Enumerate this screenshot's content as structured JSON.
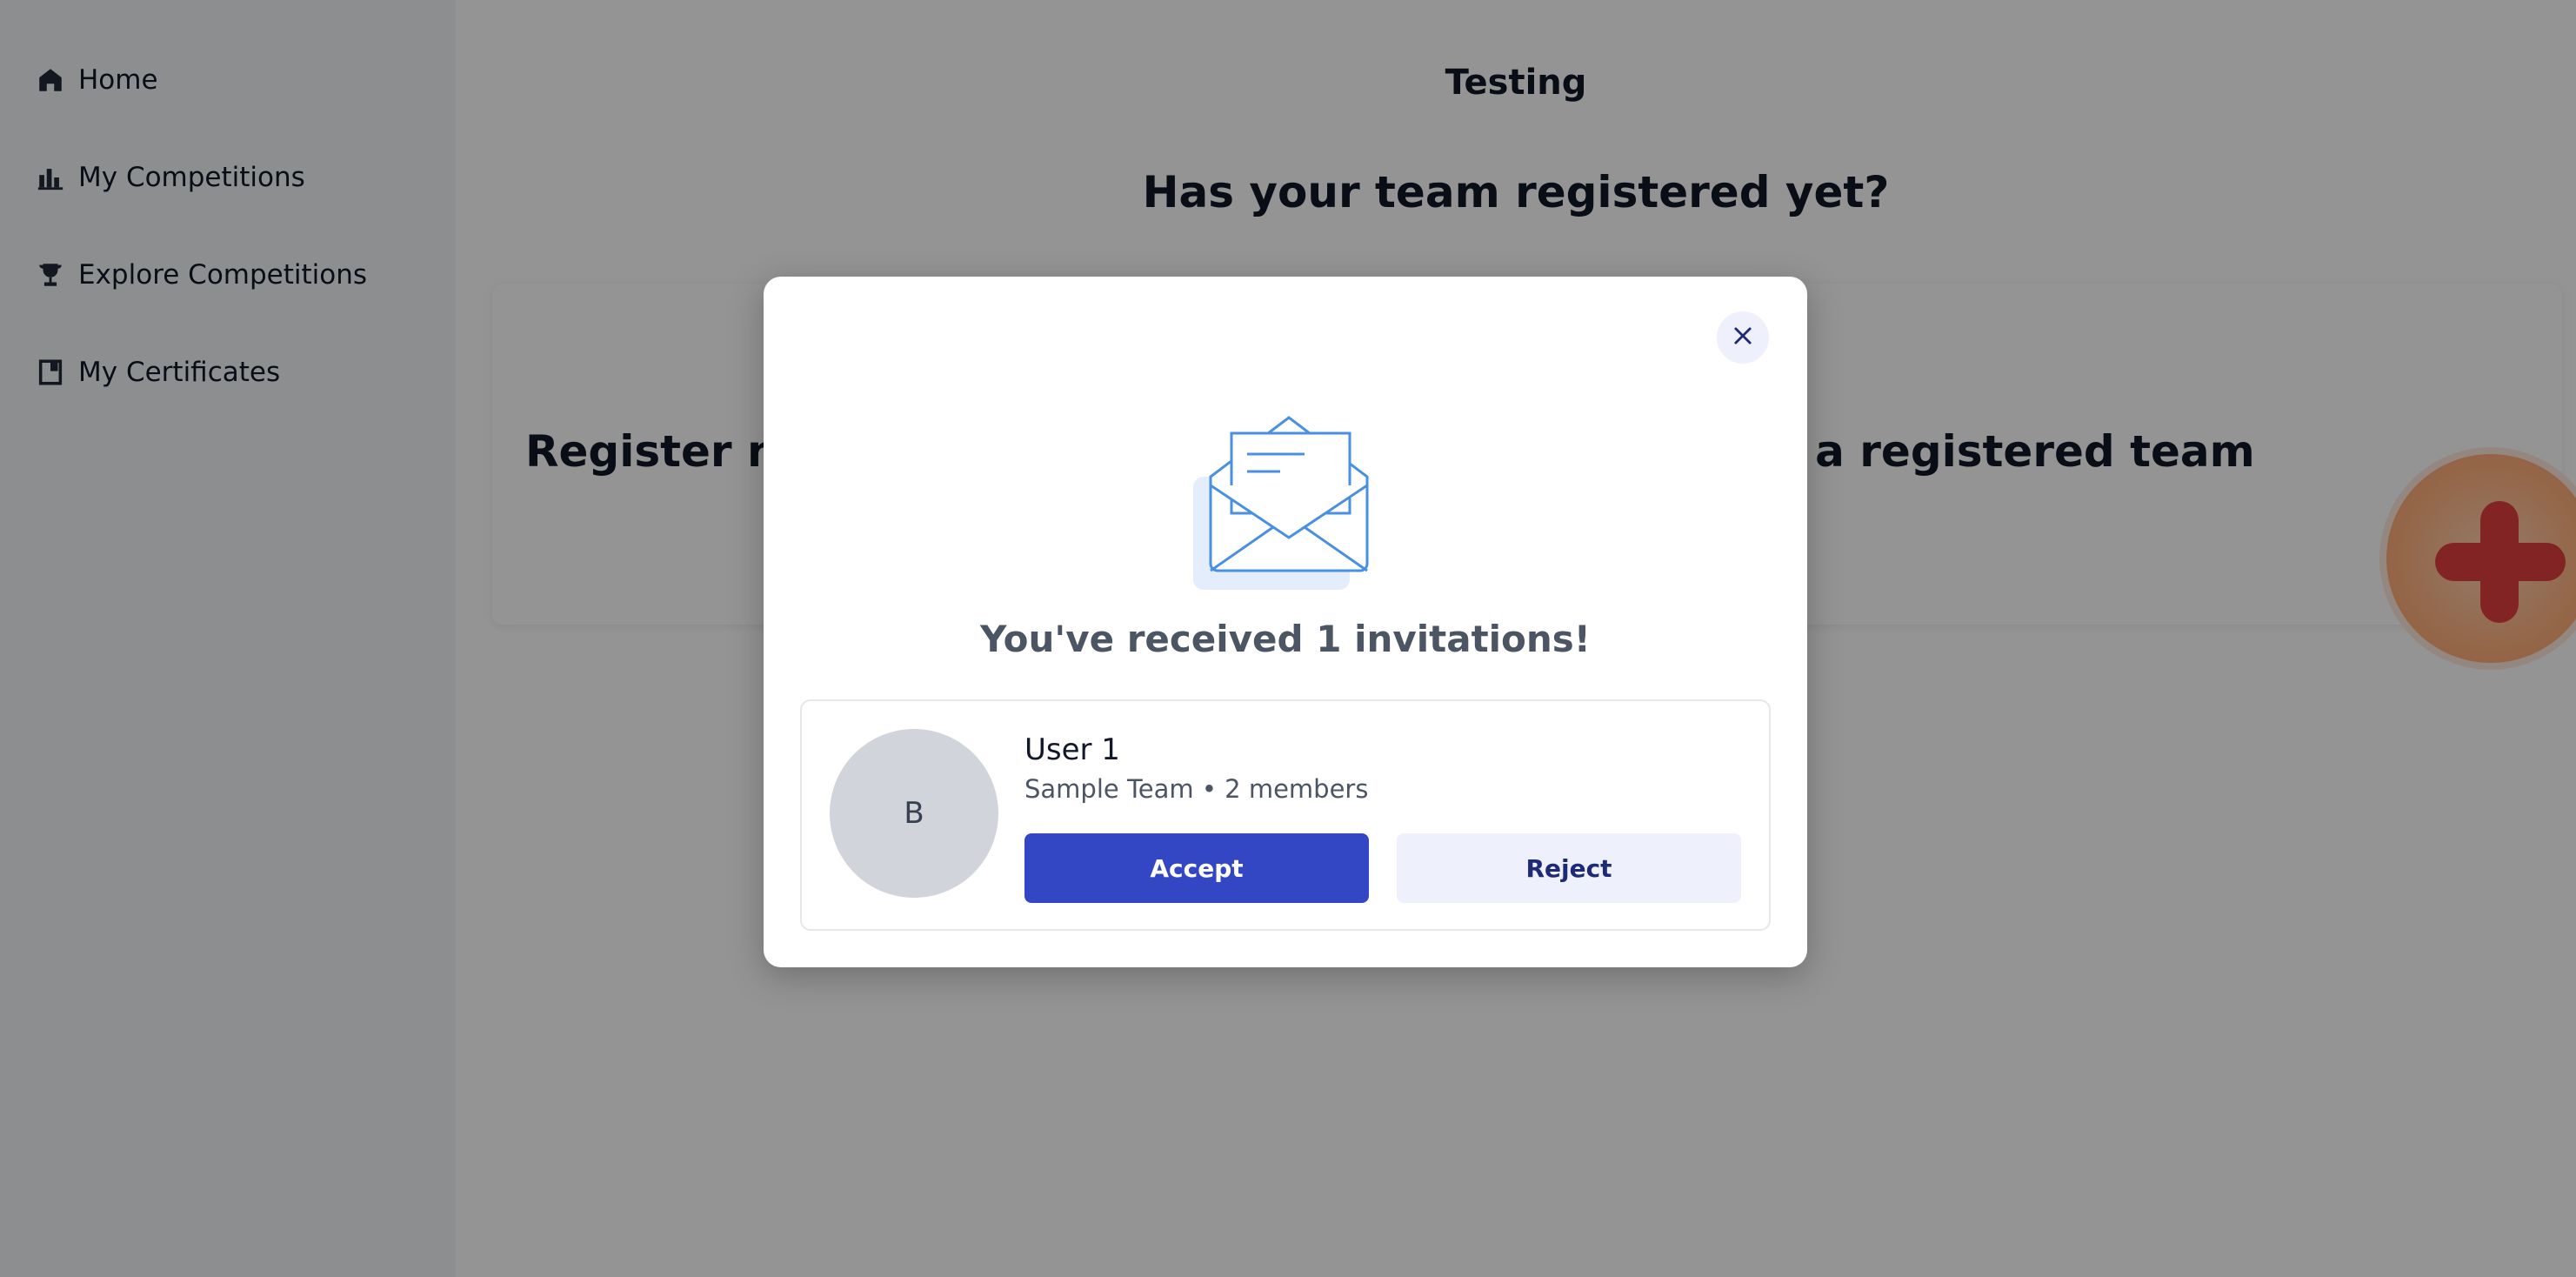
{
  "sidebar": {
    "items": [
      {
        "label": "Home",
        "icon": "home-icon"
      },
      {
        "label": "My Competitions",
        "icon": "bar-chart-icon"
      },
      {
        "label": "Explore Competitions",
        "icon": "trophy-icon"
      },
      {
        "label": "My Certificates",
        "icon": "certificate-icon"
      }
    ]
  },
  "main": {
    "title": "Testing",
    "subtitle": "Has your team registered yet?",
    "card_left_text": "Register new team",
    "card_right_text": "Join a registered team"
  },
  "fab": {
    "icon": "plus-icon"
  },
  "modal": {
    "title": "You've received 1 invitations!",
    "close_icon": "close-icon",
    "illustration": "envelope-icon",
    "invitations": [
      {
        "avatar_letter": "B",
        "inviter": "User 1",
        "team": "Sample Team • 2 members",
        "accept_label": "Accept",
        "reject_label": "Reject"
      }
    ]
  },
  "colors": {
    "accent": "#3347c4",
    "reject_bg": "#eef0fb",
    "fab_plus": "#e23f3f"
  }
}
